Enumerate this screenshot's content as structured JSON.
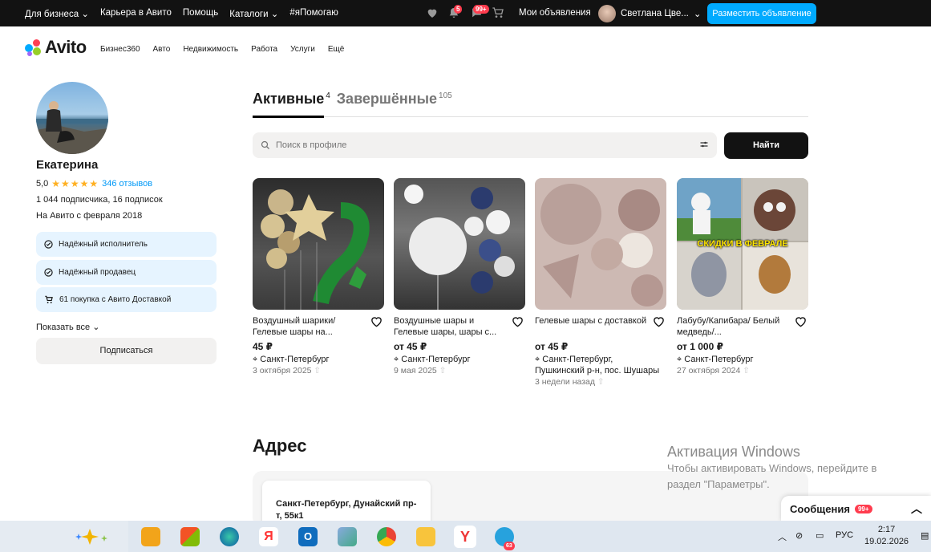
{
  "topbar": {
    "nav": [
      "Для бизнеса",
      "Карьера в Авито",
      "Помощь",
      "Каталоги",
      "#яПомогаю"
    ],
    "notif_badge": "5",
    "chat_badge": "99+",
    "my_ads": "Мои объявления",
    "user_name": "Светлана Цве...",
    "place_ad": "Разместить объявление"
  },
  "logo": {
    "text": "Avito"
  },
  "catnav": [
    "Бизнес360",
    "Авто",
    "Недвижимость",
    "Работа",
    "Услуги",
    "Ещё"
  ],
  "profile": {
    "name": "Екатерина",
    "rating": "5,0",
    "reviews": "346 отзывов",
    "subs": "1 044 подписчика, 16 подписок",
    "since": "На Авито с февраля 2018",
    "badges": [
      "Надёжный исполнитель",
      "Надёжный продавец",
      "61 покупка с Авито Доставкой"
    ],
    "show_all": "Показать все",
    "subscribe": "Подписаться"
  },
  "tabs": [
    {
      "label": "Активные",
      "count": "4"
    },
    {
      "label": "Завершённые",
      "count": "105"
    }
  ],
  "search": {
    "placeholder": "Поиск в профиле",
    "button": "Найти"
  },
  "items": [
    {
      "title": "Воздушный шарики/ Гелевые шары на...",
      "price": "45 ₽",
      "location": "Санкт-Петербург",
      "date": "3 октября 2025"
    },
    {
      "title": "Воздушные шары и Гелевые шары, шары с...",
      "price": "от 45 ₽",
      "location": "Санкт-Петербург",
      "date": "9 мая 2025"
    },
    {
      "title": "Гелевые шары с доставкой",
      "price": "от 45 ₽",
      "location": "Санкт-Петербург, Пушкинский р-н, пос. Шушары",
      "date": "3 недели назад"
    },
    {
      "title": "Лабубу/Капибара/ Белый медведь/...",
      "price": "от 1 000 ₽",
      "location": "Санкт-Петербург",
      "date": "27 октября 2024",
      "overlay": "СКИДКИ В ФЕВРАЛЕ"
    }
  ],
  "address": {
    "title": "Адрес",
    "text": "Санкт-Петербург, Дунайский пр-т, 55к1"
  },
  "watermark": {
    "line1": "Активация Windows",
    "line2": "Чтобы активировать Windows, перейдите в",
    "line3": "раздел \"Параметры\"."
  },
  "messages": {
    "label": "Сообщения",
    "badge": "99+"
  },
  "taskbar": {
    "lang": "РУС",
    "time": "2:17",
    "date": "19.02.2026",
    "telegram_badge": "63"
  }
}
